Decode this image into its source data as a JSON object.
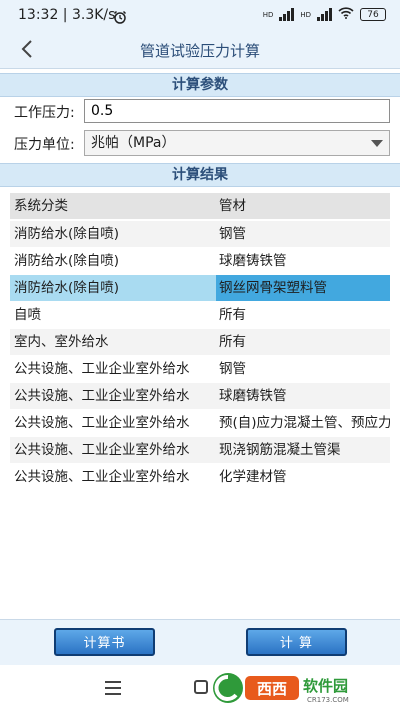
{
  "status": {
    "time_speed": "13:32 | 3.3K/s",
    "hd1": "HD",
    "hd2": "HD",
    "battery": "76"
  },
  "header": {
    "title": "管道试验压力计算"
  },
  "params": {
    "section_title": "计算参数",
    "pressure_label": "工作压力:",
    "pressure_value": "0.5",
    "unit_label": "压力单位:",
    "unit_selected": "兆帕（MPa）"
  },
  "results": {
    "section_title": "计算结果",
    "columns": [
      "系统分类",
      "管材"
    ],
    "rows": [
      [
        "消防给水(除自喷)",
        "钢管"
      ],
      [
        "消防给水(除自喷)",
        "球磨铸铁管"
      ],
      [
        "消防给水(除自喷)",
        "钢丝网骨架塑料管"
      ],
      [
        "自喷",
        "所有"
      ],
      [
        "室内、室外给水",
        "所有"
      ],
      [
        "公共设施、工业企业室外给水",
        "钢管"
      ],
      [
        "公共设施、工业企业室外给水",
        "球磨铸铁管"
      ],
      [
        "公共设施、工业企业室外给水",
        "预(自)应力混凝土管、预应力"
      ],
      [
        "公共设施、工业企业室外给水",
        "现浇钢筋混凝土管渠"
      ],
      [
        "公共设施、工业企业室外给水",
        "化学建材管"
      ]
    ],
    "selected_row": 2
  },
  "buttons": {
    "book": "计算书",
    "calc": "计 算"
  },
  "watermark": {
    "brand": "西西软件园",
    "site": "CR173.COM"
  }
}
